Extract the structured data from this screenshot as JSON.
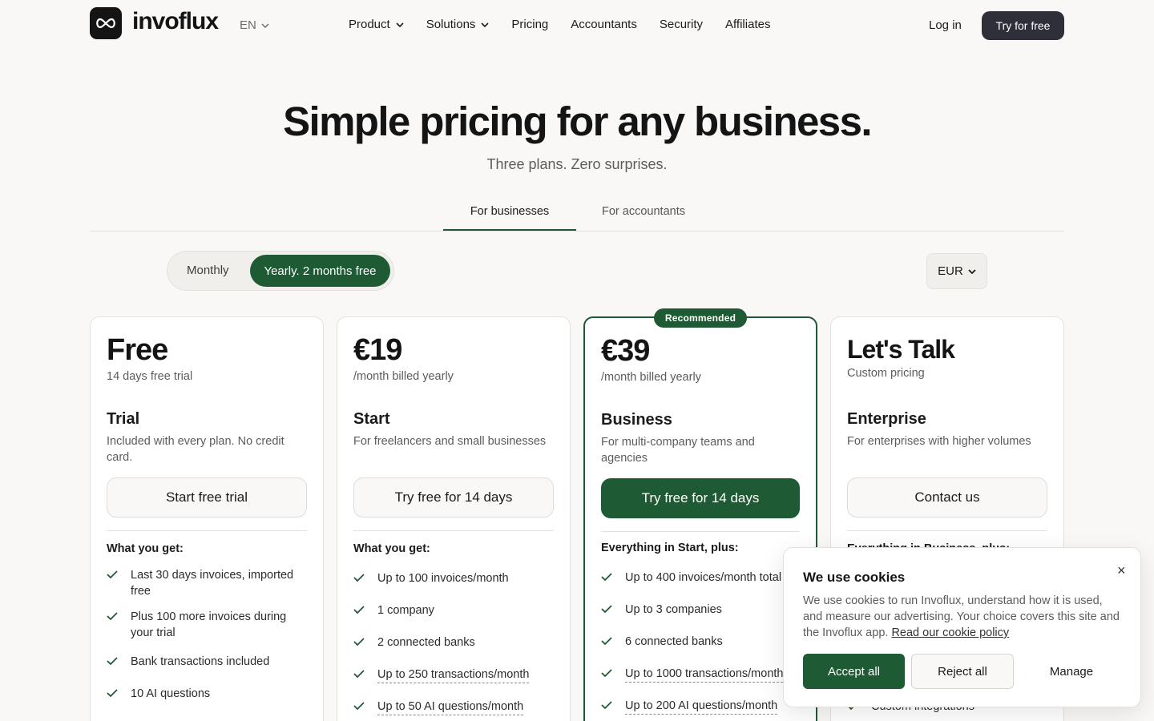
{
  "header": {
    "brand": "invoflux",
    "language": "EN",
    "nav": [
      {
        "label": "Product",
        "has_menu": true
      },
      {
        "label": "Solutions",
        "has_menu": true
      },
      {
        "label": "Pricing",
        "has_menu": false
      },
      {
        "label": "Accountants",
        "has_menu": false
      },
      {
        "label": "Security",
        "has_menu": false
      },
      {
        "label": "Affiliates",
        "has_menu": false
      }
    ],
    "login": "Log in",
    "cta": "Try for free"
  },
  "hero": {
    "title": "Simple pricing for any business.",
    "subtitle": "Three plans. Zero surprises."
  },
  "tabs": {
    "businesses": "For businesses",
    "accountants": "For accountants",
    "active": "businesses"
  },
  "billing": {
    "monthly": "Monthly",
    "yearly": "Yearly. 2 months free",
    "selected": "yearly",
    "currency": "EUR"
  },
  "plans": [
    {
      "price": "Free",
      "price_note": "14 days free trial",
      "name": "Trial",
      "description": "Included with every plan. No credit card.",
      "cta": "Start free trial",
      "features_title": "What you get:",
      "features": [
        "Last 30 days invoices, imported free",
        "Plus 100 more invoices during your trial",
        "Bank transactions included",
        "10 AI questions"
      ]
    },
    {
      "price": "€19",
      "price_note": "/month billed yearly",
      "name": "Start",
      "description": "For freelancers and small businesses",
      "cta": "Try free for 14 days",
      "features_title": "What you get:",
      "features": [
        "Up to 100 invoices/month",
        "1 company",
        "2 connected banks",
        "Up to 250 transactions/month",
        "Up to 50 AI questions/month"
      ]
    },
    {
      "badge": "Recommended",
      "price": "€39",
      "price_note": "/month billed yearly",
      "name": "Business",
      "description": "For multi-company teams and agencies",
      "cta": "Try free for 14 days",
      "features_title": "Everything in Start, plus:",
      "features": [
        "Up to 400 invoices/month total",
        "Up to 3 companies",
        "6 connected banks",
        "Up to 1000 transactions/month",
        "Up to 200 AI questions/month"
      ]
    },
    {
      "price": "Let's Talk",
      "price_note": "Custom pricing",
      "name": "Enterprise",
      "description": "For enterprises with higher volumes",
      "cta": "Contact us",
      "features_title": "Everything in Business, plus:",
      "features": [
        "Custom integrations"
      ]
    }
  ],
  "cookie": {
    "title": "We use cookies",
    "text": "We use cookies to run Invoflux, understand how it is used, and measure our advertising. Your choice covers this site and the Invoflux app.",
    "link": "Read our cookie policy",
    "accept": "Accept all",
    "reject": "Reject all",
    "manage": "Manage",
    "close": "×"
  },
  "colors": {
    "accent": "#1e5a34",
    "dark_button": "#2f2f39",
    "background": "#f9f8f6"
  },
  "icons": {
    "logo": "infinity-icon",
    "chevron": "chevron-down-icon",
    "check": "check-icon",
    "close": "close-icon"
  }
}
